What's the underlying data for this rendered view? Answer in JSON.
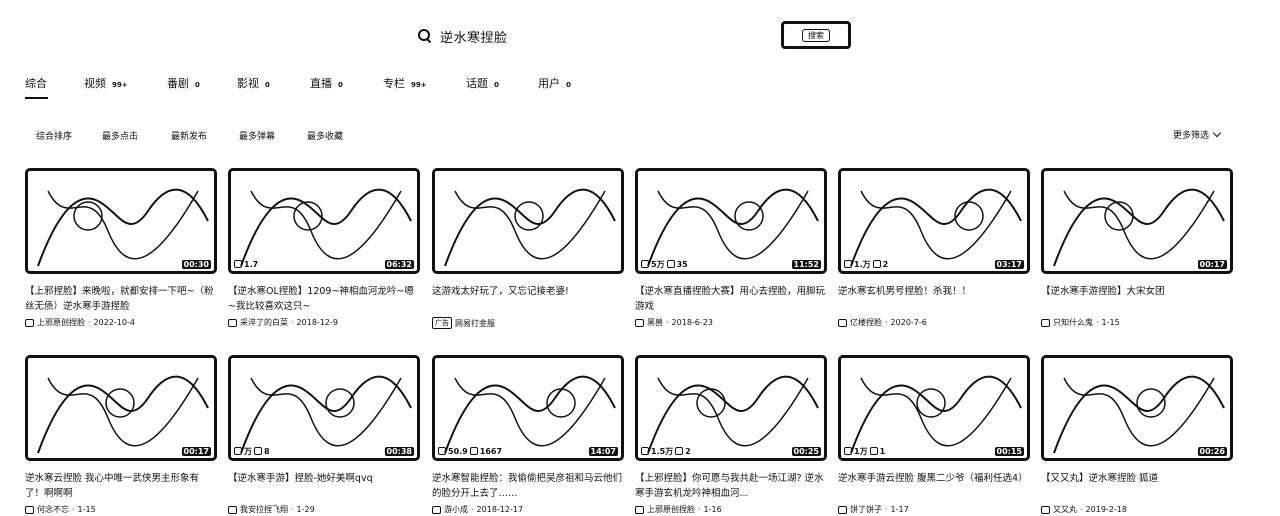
{
  "search": {
    "query": "逆水寒捏脸",
    "button_label": "搜索"
  },
  "tabs": [
    {
      "label": "综合",
      "count": ""
    },
    {
      "label": "视频",
      "count": "99+"
    },
    {
      "label": "番剧",
      "count": "0"
    },
    {
      "label": "影视",
      "count": "0"
    },
    {
      "label": "直播",
      "count": "0"
    },
    {
      "label": "专栏",
      "count": "99+"
    },
    {
      "label": "话题",
      "count": "0"
    },
    {
      "label": "用户",
      "count": "0"
    }
  ],
  "sort": [
    "综合排序",
    "最多点击",
    "最新发布",
    "最多弹幕",
    "最多收藏"
  ],
  "more_filter": "更多筛选",
  "videos": [
    {
      "title": "【上邪捏脸】来晚啦，就都安排一下吧~（粉丝无债）逆水寒手游捏脸",
      "views": "",
      "danmaku": "",
      "duration": "00:30",
      "uploader": "上邪原创捏脸",
      "date": "2022-10-4",
      "ad": ""
    },
    {
      "title": "【逆水寒OL捏脸】1209~神相血河龙吟~嗯~我比较喜欢这只~",
      "views": "1.7",
      "danmaku": "",
      "duration": "06:32",
      "uploader": "采淬了的白菜",
      "date": "2018-12-9",
      "ad": ""
    },
    {
      "title": "这游戏太好玩了，又忘记接老婆!",
      "views": "",
      "danmaku": "",
      "duration": "",
      "uploader": "网易打金服",
      "date": "",
      "ad": "广告"
    },
    {
      "title": "【逆水寒直播捏脸大赛】用心去捏脸，用脚玩游戏",
      "views": "5万",
      "danmaku": "35",
      "duration": "11:52",
      "uploader": "黑兽",
      "date": "2018-6-23",
      "ad": ""
    },
    {
      "title": "逆水寒玄机男号捏脸！杀我！！",
      "views": "1.万",
      "danmaku": "2",
      "duration": "03:17",
      "uploader": "亿楼捏脸",
      "date": "2020-7-6",
      "ad": ""
    },
    {
      "title": "【逆水寒手游捏脸】大宋女团",
      "views": "",
      "danmaku": "",
      "duration": "00:17",
      "uploader": "只知什么鬼",
      "date": "1-15",
      "ad": ""
    },
    {
      "title": "逆水寒云捏脸 我心中唯一武侠男主形象有了！啊啊啊",
      "views": "",
      "danmaku": "",
      "duration": "00:17",
      "uploader": "何念不忘",
      "date": "1-15",
      "ad": ""
    },
    {
      "title": "【逆水寒手游】捏脸-她好美啊qvq",
      "views": "万",
      "danmaku": "8",
      "duration": "00:38",
      "uploader": "我安拉捏飞翔",
      "date": "1-29",
      "ad": ""
    },
    {
      "title": "逆水寒智能捏脸：我偷偷把吴彦祖和马云他们的脸分开上去了……",
      "views": "50.9",
      "danmaku": "1667",
      "duration": "14:07",
      "uploader": "游小成",
      "date": "2018-12-17",
      "ad": ""
    },
    {
      "title": "【上邪捏脸】你可愿与我共赴一场江湖? 逆水寒手游玄机龙吟神相血河...",
      "views": "1.5万",
      "danmaku": "2",
      "duration": "00:25",
      "uploader": "上邪原创捏脸",
      "date": "1-16",
      "ad": ""
    },
    {
      "title": "逆水寒手游云捏脸 腹黑二少爷（福利任选4）",
      "views": "1万",
      "danmaku": "1",
      "duration": "00:15",
      "uploader": "饼了饼子",
      "date": "1-17",
      "ad": ""
    },
    {
      "title": "【又又丸】逆水寒捏脸 狐道",
      "views": "",
      "danmaku": "",
      "duration": "00:26",
      "uploader": "又又丸",
      "date": "2019-2-18",
      "ad": ""
    }
  ]
}
